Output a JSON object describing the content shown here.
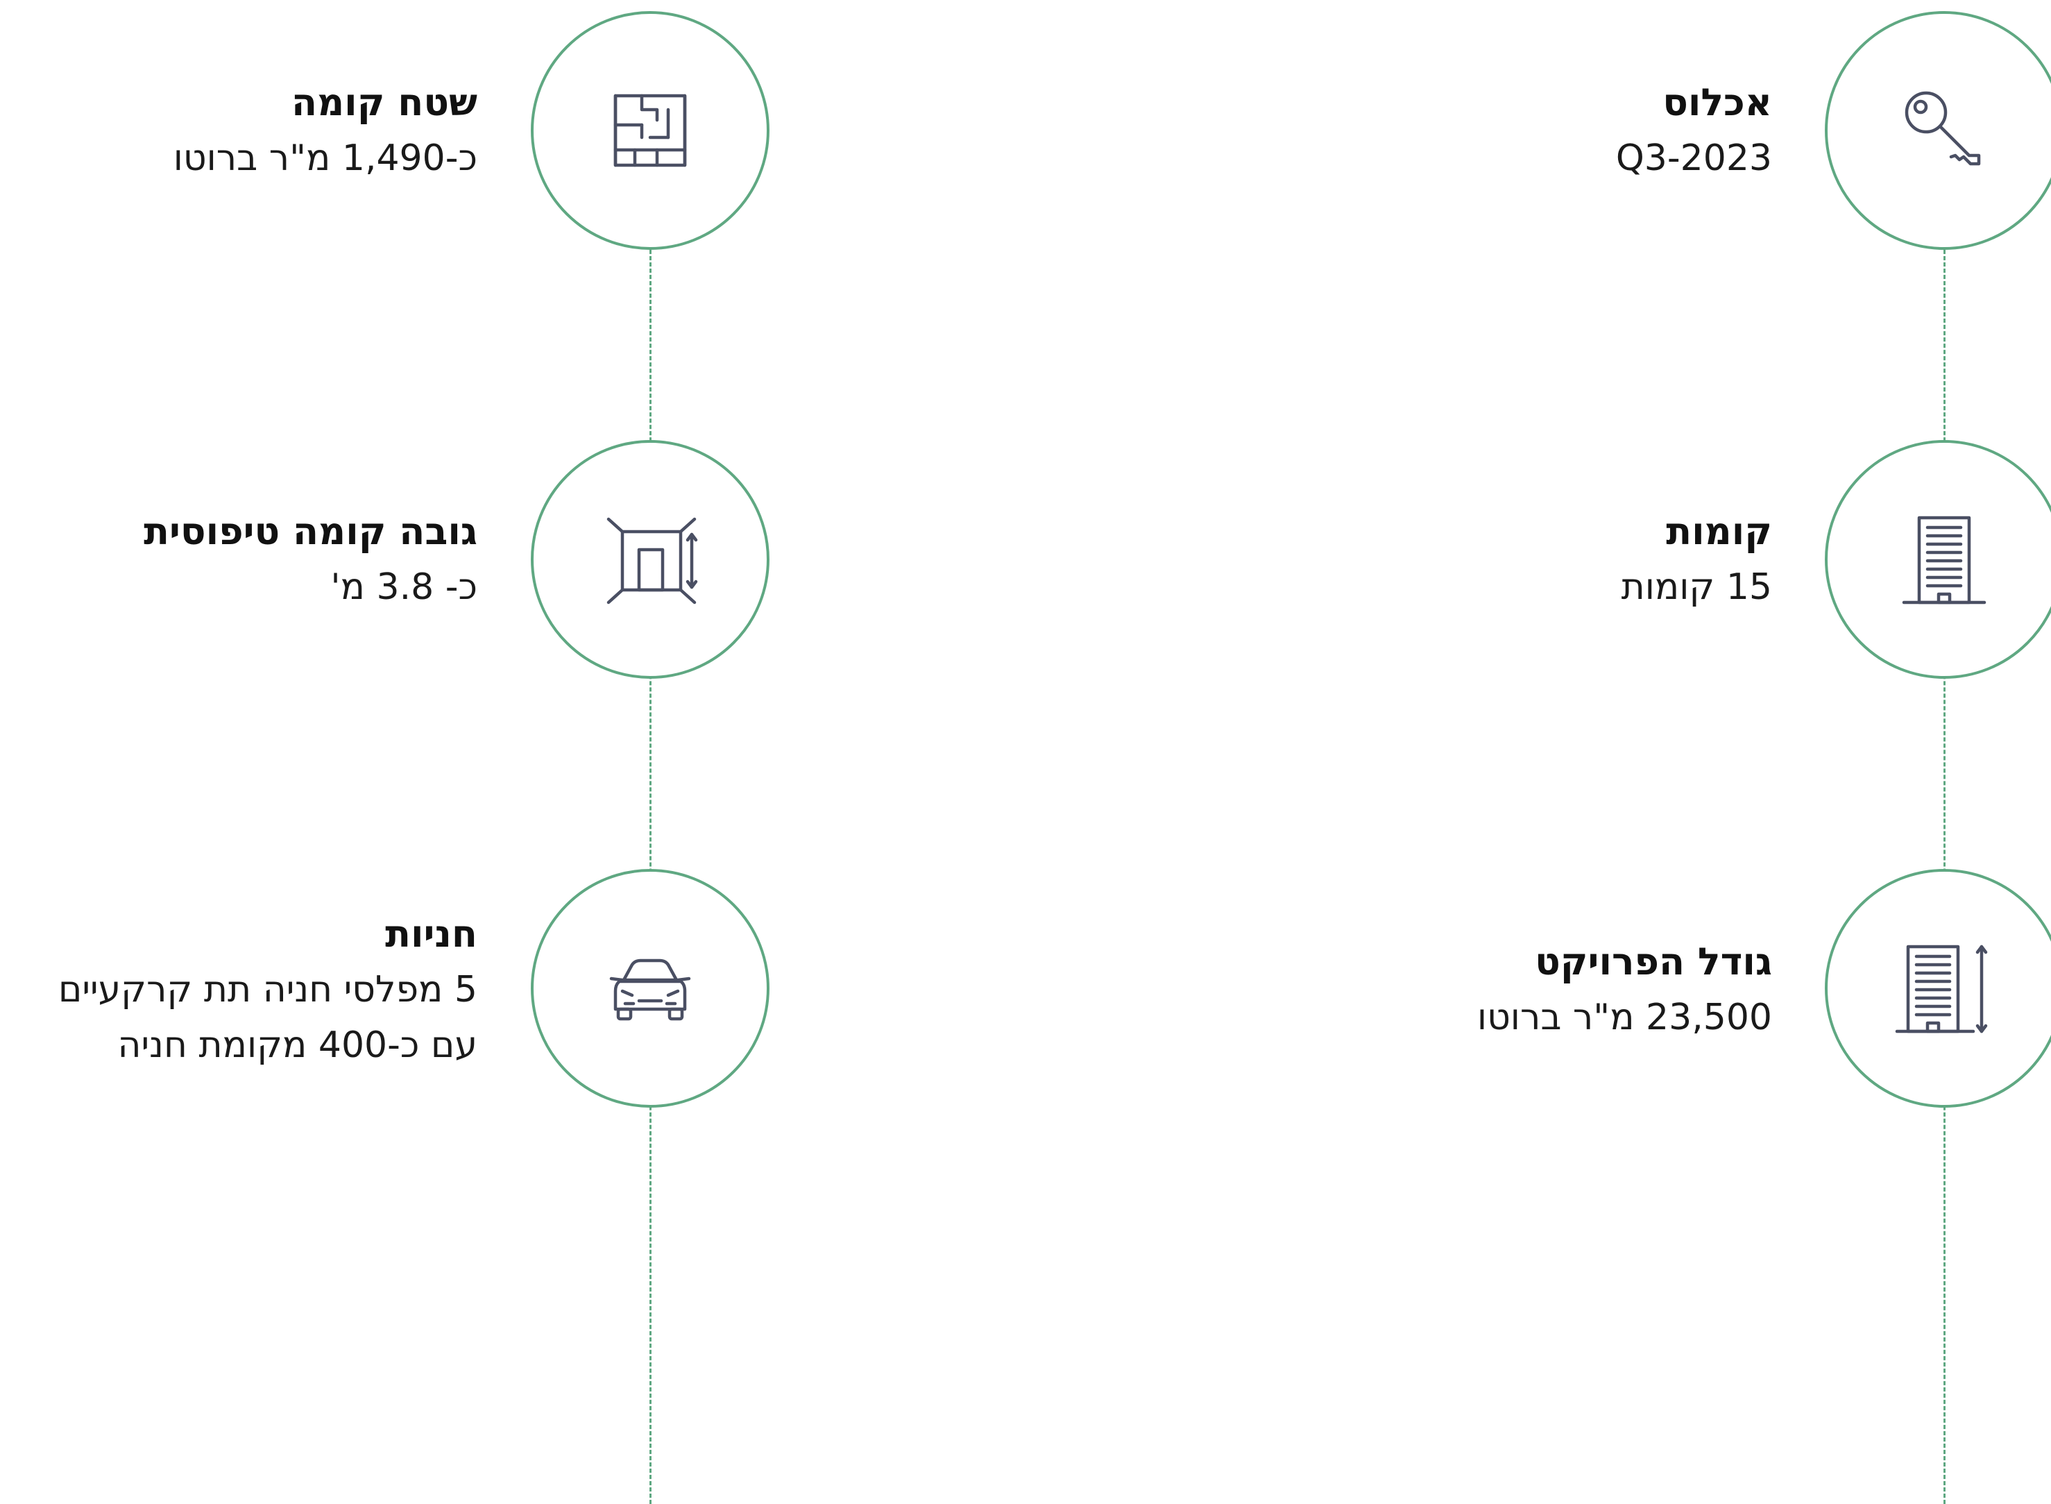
{
  "colors": {
    "accent": "#5fa882",
    "icon": "#4a4f63",
    "text": "#111111",
    "background": "#ffffff"
  },
  "right_column": [
    {
      "icon": "key-icon",
      "title": "אכלוס",
      "value": "Q3-2023"
    },
    {
      "icon": "building-icon",
      "title": "קומות",
      "value": "15 קומות"
    },
    {
      "icon": "building-height-icon",
      "title": "גודל הפרויקט",
      "value": "23,500 מ\"ר ברוטו"
    }
  ],
  "left_column": [
    {
      "icon": "floor-plan-icon",
      "title": "שטח קומה",
      "value": "כ-1,490 מ\"ר ברוטו"
    },
    {
      "icon": "ceiling-height-icon",
      "title": "גובה קומה טיפוסית",
      "value": "כ- 3.8 מ'"
    },
    {
      "icon": "car-icon",
      "title": "חניות",
      "value": "5 מפלסי חניה תת קרקעיים",
      "value_line2": "עם כ-400 מקומת חניה"
    }
  ]
}
